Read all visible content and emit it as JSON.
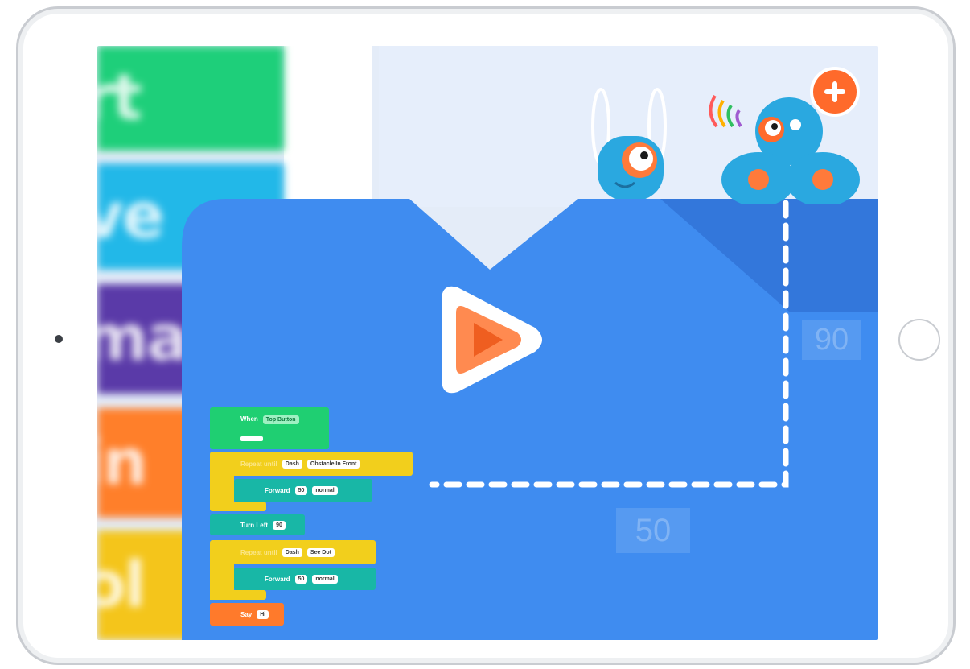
{
  "sidebar": {
    "categories": [
      {
        "label": "rt",
        "color": "#1ecf7a"
      },
      {
        "label": "ve",
        "color": "#22b8e8"
      },
      {
        "label": "mac",
        "color": "#5a3aa8"
      },
      {
        "label": "in",
        "color": "#ff7f2a"
      },
      {
        "label": "ol",
        "color": "#f4c51b"
      }
    ]
  },
  "canvas": {
    "turn_label": "90",
    "distance_label": "50",
    "play_icon": "play-icon",
    "add_icon": "plus-icon"
  },
  "code": {
    "when": {
      "label": "When",
      "trigger": "Top Button"
    },
    "repeat1": {
      "label": "Repeat until",
      "robot": "Dash",
      "condition": "Obstacle In Front"
    },
    "forward1": {
      "label": "Forward",
      "distance": "50",
      "speed": "normal"
    },
    "turn": {
      "label": "Turn Left",
      "angle": "90"
    },
    "repeat2": {
      "label": "Repeat until",
      "robot": "Dash",
      "condition": "See Dot"
    },
    "forward2": {
      "label": "Forward",
      "distance": "50",
      "speed": "normal"
    },
    "say": {
      "label": "Say",
      "text": "Hi"
    }
  },
  "colors": {
    "panel_blue": "#3f8cf0",
    "accent_orange": "#ff6a2b",
    "start_green": "#1fcf72",
    "control_yellow": "#f2cf1c",
    "drive_teal": "#18b7a6"
  }
}
